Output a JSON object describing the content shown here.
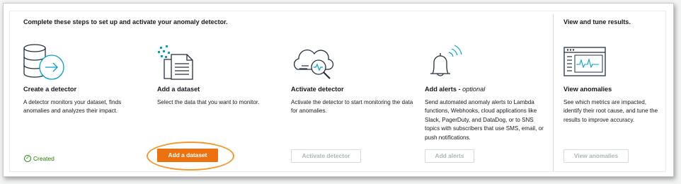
{
  "heading_main": "Complete these steps to set up and activate your anomaly detector.",
  "heading_side": "View and tune results.",
  "steps": [
    {
      "icon": "database-arrow-icon",
      "title": "Create a detector",
      "description": "A detector monitors your dataset, finds anomalies and analyzes their impact.",
      "status": "Created"
    },
    {
      "icon": "dataset-document-icon",
      "title": "Add a dataset",
      "description": "Select the data that you want to monitor.",
      "button": "Add a dataset"
    },
    {
      "icon": "cloud-magnifier-icon",
      "title": "Activate detector",
      "description": "Activate the detector to start monitoring the data for anomalies.",
      "button": "Activate detector"
    },
    {
      "icon": "bell-alert-icon",
      "title": "Add alerts",
      "title_suffix": "optional",
      "title_sep": " - ",
      "description": "Send automated anomaly alerts to Lambda functions, Webhooks, cloud applications like Slack, PagerDuty, and DataDog, or to SNS topics with subscribers that use SMS, email, or push notifications.",
      "button": "Add alerts"
    },
    {
      "icon": "monitor-chart-icon",
      "title": "View anomalies",
      "description": "See which metrics are impacted, identify their root cause, and tune the results to improve accuracy.",
      "button": "View anomalies"
    }
  ],
  "colors": {
    "primary_button": "#ec7211",
    "success_text": "#1d8102",
    "disabled_text": "#aab7b8",
    "highlight_ring": "#f29a2e"
  }
}
